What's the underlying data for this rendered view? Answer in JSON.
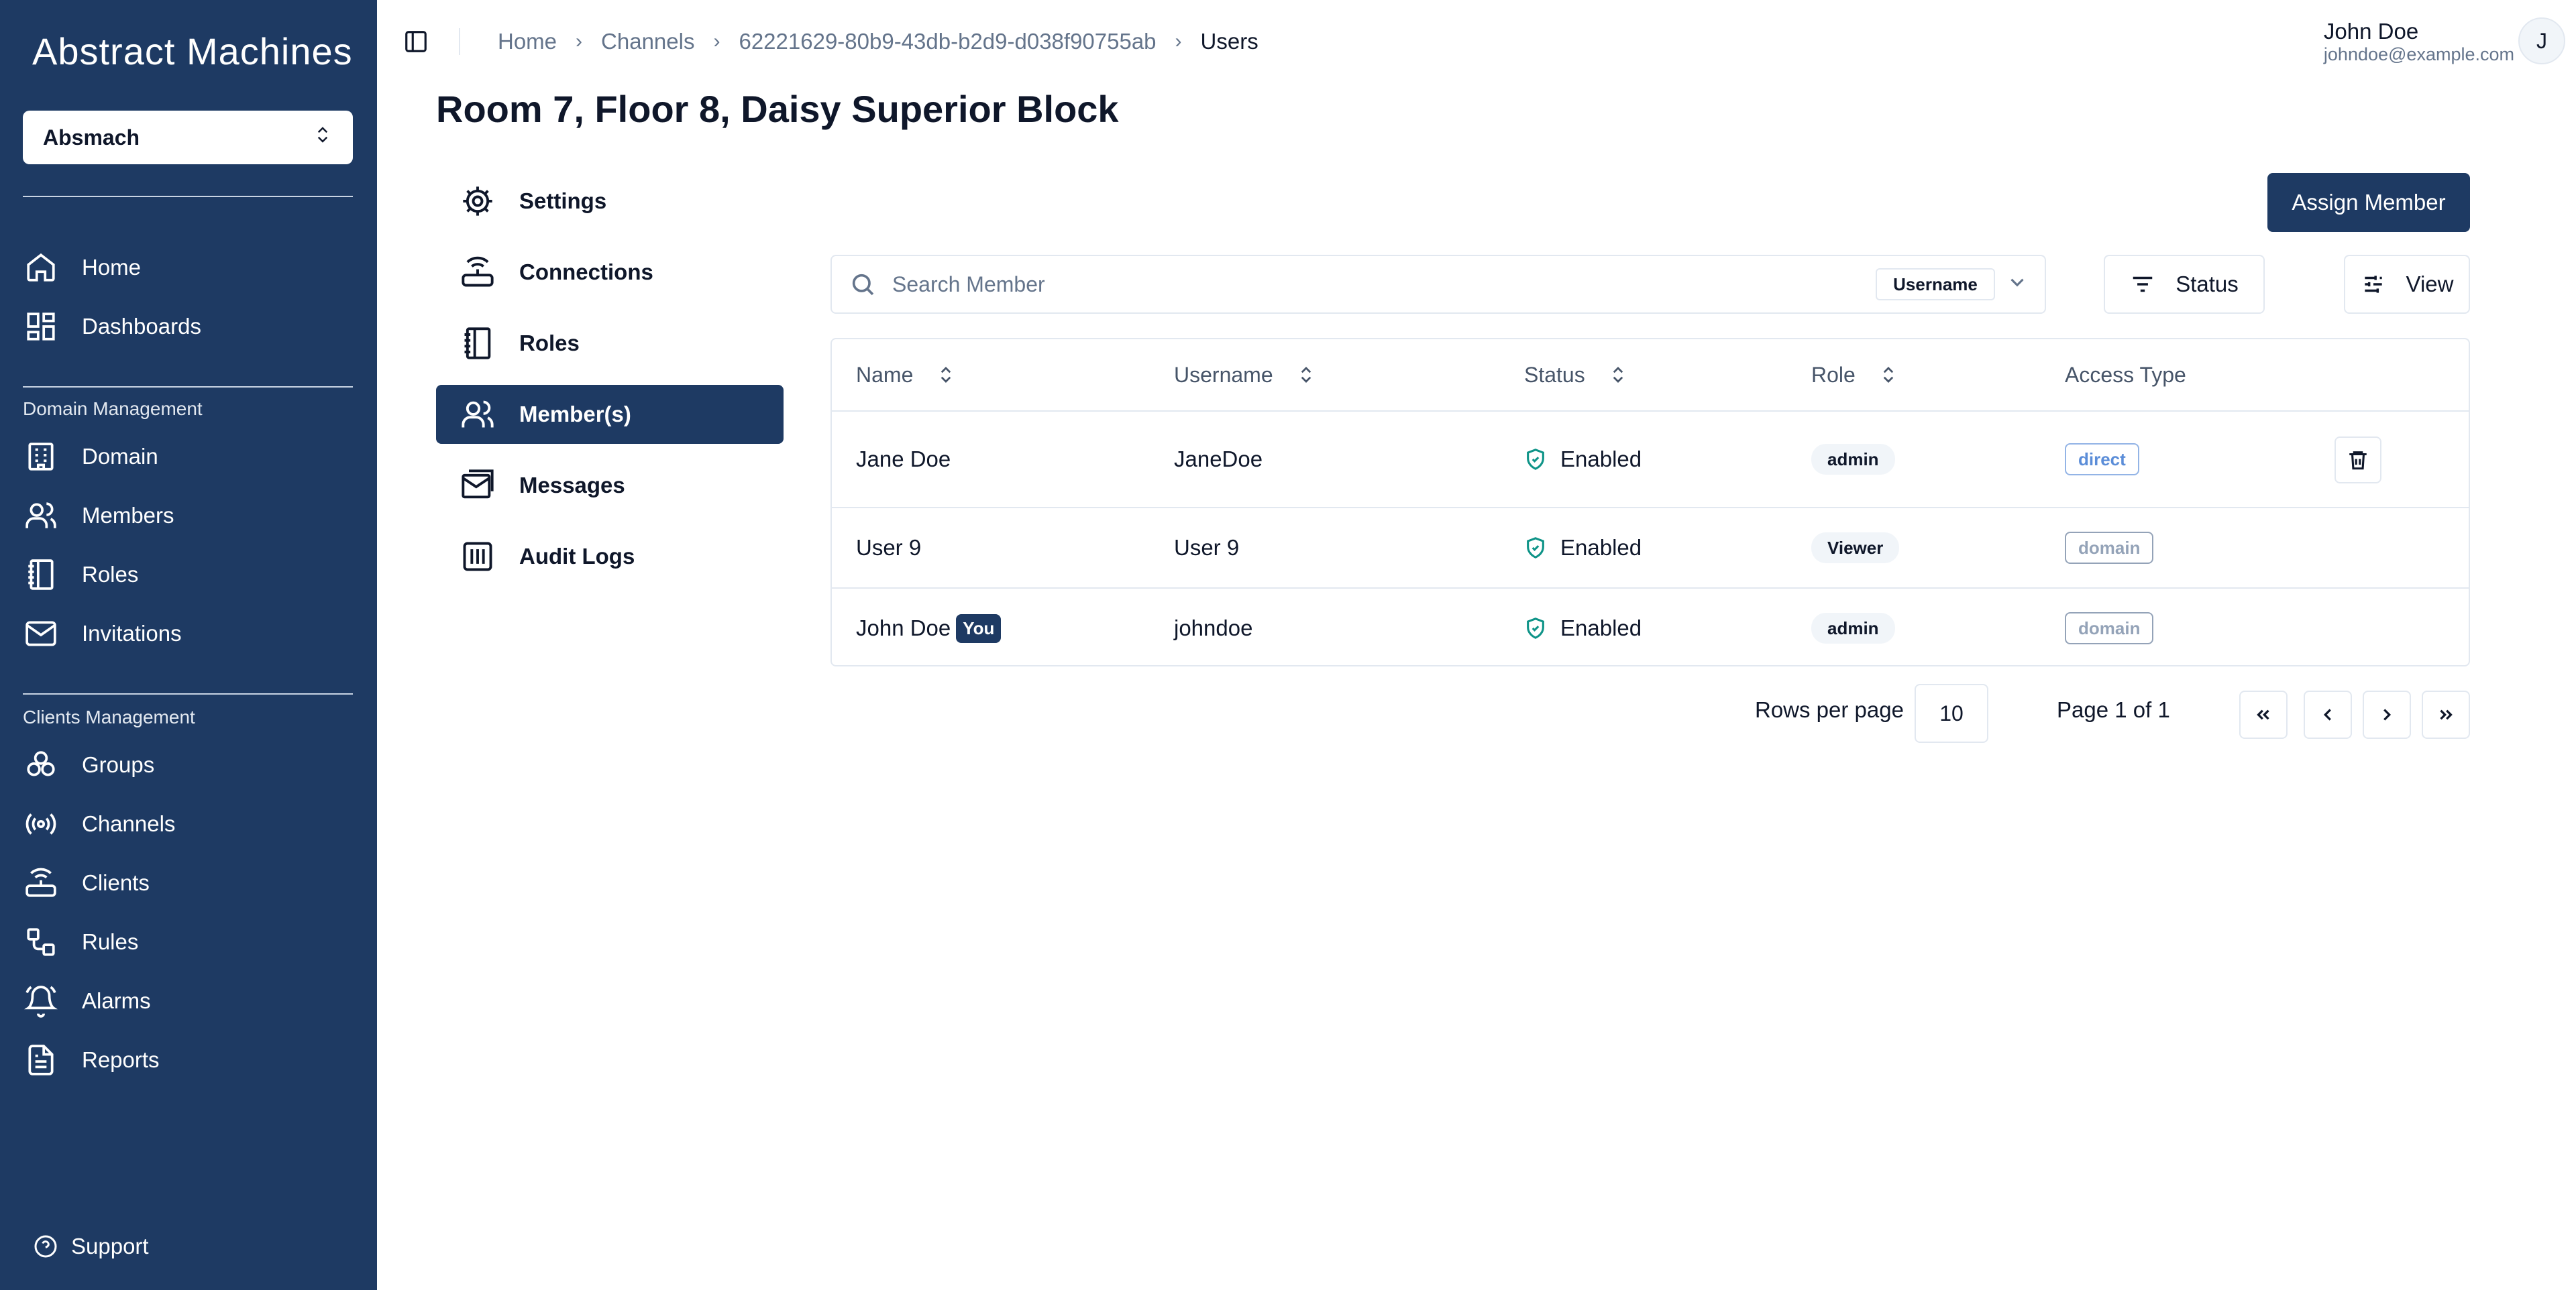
{
  "sidebar": {
    "logo": "Abstract Machines",
    "org_select": "Absmach",
    "main_items": [
      {
        "label": "Home",
        "icon": "home-icon"
      },
      {
        "label": "Dashboards",
        "icon": "dashboard-icon"
      }
    ],
    "domain_section": "Domain Management",
    "domain_items": [
      {
        "label": "Domain",
        "icon": "building-icon"
      },
      {
        "label": "Members",
        "icon": "users-icon"
      },
      {
        "label": "Roles",
        "icon": "notebook-icon"
      },
      {
        "label": "Invitations",
        "icon": "mail-icon"
      }
    ],
    "clients_section": "Clients Management",
    "clients_items": [
      {
        "label": "Groups",
        "icon": "groups-icon"
      },
      {
        "label": "Channels",
        "icon": "radio-icon"
      },
      {
        "label": "Clients",
        "icon": "router-icon"
      },
      {
        "label": "Rules",
        "icon": "workflow-icon"
      },
      {
        "label": "Alarms",
        "icon": "bell-icon"
      },
      {
        "label": "Reports",
        "icon": "file-icon"
      }
    ],
    "support": "Support"
  },
  "header": {
    "breadcrumb": [
      "Home",
      "Channels",
      "62221629-80b9-43db-b2d9-d038f90755ab",
      "Users"
    ],
    "user_name": "John Doe",
    "user_email": "johndoe@example.com",
    "avatar_initial": "J"
  },
  "page_title": "Room 7, Floor 8, Daisy Superior Block",
  "subnav": [
    {
      "label": "Settings",
      "icon": "settings-icon",
      "active": false
    },
    {
      "label": "Connections",
      "icon": "router-icon",
      "active": false
    },
    {
      "label": "Roles",
      "icon": "notebook-icon",
      "active": false
    },
    {
      "label": "Member(s)",
      "icon": "users-icon",
      "active": true
    },
    {
      "label": "Messages",
      "icon": "messages-icon",
      "active": false
    },
    {
      "label": "Audit Logs",
      "icon": "audit-icon",
      "active": false
    }
  ],
  "toolbar": {
    "assign_label": "Assign Member",
    "search_placeholder": "Search Member",
    "search_filter": "Username",
    "status_label": "Status",
    "view_label": "View"
  },
  "table": {
    "columns": [
      "Name",
      "Username",
      "Status",
      "Role",
      "Access Type"
    ],
    "rows": [
      {
        "name": "Jane Doe",
        "you": "",
        "username": "JaneDoe",
        "status": "Enabled",
        "role": "admin",
        "access": "direct"
      },
      {
        "name": "User 9",
        "you": "",
        "username": "User 9",
        "status": "Enabled",
        "role": "Viewer",
        "access": "domain"
      },
      {
        "name": "John Doe",
        "you": "You",
        "username": "johndoe",
        "status": "Enabled",
        "role": "admin",
        "access": "domain"
      }
    ]
  },
  "pagination": {
    "rows_label": "Rows per page",
    "rows_value": "10",
    "page_label": "Page 1 of 1"
  },
  "colors": {
    "sidebar_bg": "#1e3a63",
    "accent": "#1e3a63",
    "enabled": "#0f9488",
    "direct_badge": "#5b8dd8",
    "domain_badge": "#94a3b8"
  }
}
